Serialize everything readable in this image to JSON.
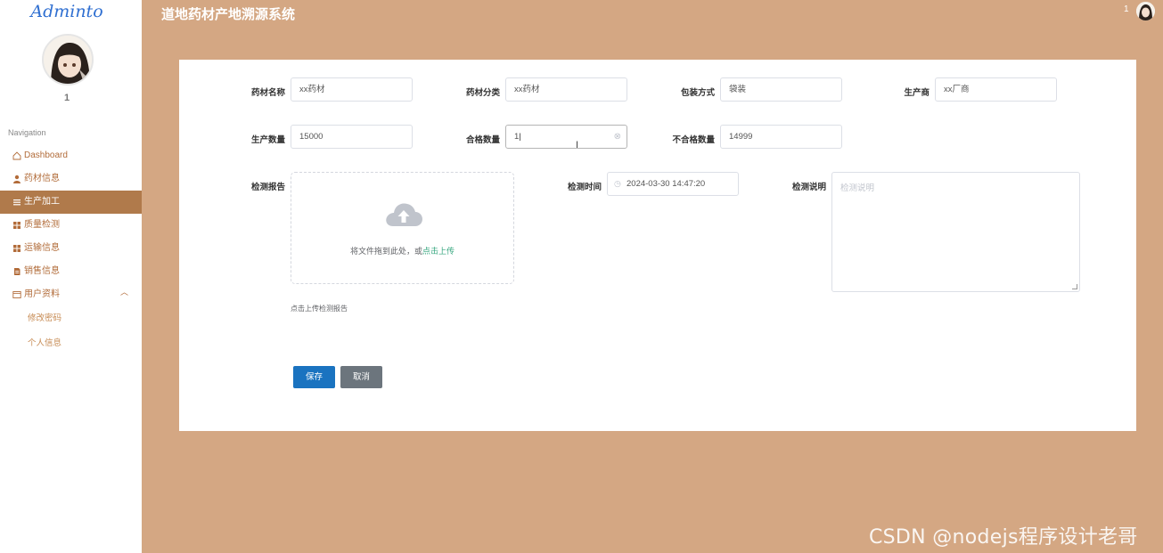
{
  "app": {
    "logo": "Adminto",
    "title": "道地药材产地溯源系统",
    "user_number": "1",
    "top_user_number": "1"
  },
  "sidebar": {
    "section_title": "Navigation",
    "items": [
      {
        "label": "Dashboard",
        "icon": "home-icon"
      },
      {
        "label": "药材信息",
        "icon": "user-icon"
      },
      {
        "label": "生产加工",
        "icon": "list-icon",
        "active": true
      },
      {
        "label": "质量检测",
        "icon": "grid-icon"
      },
      {
        "label": "运输信息",
        "icon": "grid-icon"
      },
      {
        "label": "销售信息",
        "icon": "file-icon"
      },
      {
        "label": "用户资料",
        "icon": "profile-card-icon",
        "expanded": true
      }
    ],
    "subitems": [
      {
        "label": "修改密码"
      },
      {
        "label": "个人信息"
      }
    ]
  },
  "form": {
    "row1": [
      {
        "label": "药材名称",
        "value": "xx药材"
      },
      {
        "label": "药材分类",
        "value": "xx药材"
      },
      {
        "label": "包装方式",
        "value": "袋装"
      },
      {
        "label": "生产商",
        "value": "xx厂商"
      }
    ],
    "row2": [
      {
        "label": "生产数量",
        "value": "15000"
      },
      {
        "label": "合格数量",
        "value": "1"
      },
      {
        "label": "不合格数量",
        "value": "14999"
      }
    ],
    "report": {
      "label": "检测报告",
      "drag_text": "将文件拖到此处，或",
      "click_text": "点击上传",
      "tip": "点击上传检测报告"
    },
    "time": {
      "label": "检测时间",
      "value": "2024-03-30 14:47:20"
    },
    "desc": {
      "label": "检测说明",
      "placeholder": "检测说明"
    },
    "buttons": {
      "save": "保存",
      "cancel": "取消"
    }
  },
  "colors": {
    "background": "#d4a783",
    "sidebar_active": "#b07a4b",
    "primary_button": "#1a73c0",
    "cancel_button": "#6c757d",
    "link_green": "#35a67e"
  },
  "watermark": "CSDN @nodejs程序设计老哥"
}
